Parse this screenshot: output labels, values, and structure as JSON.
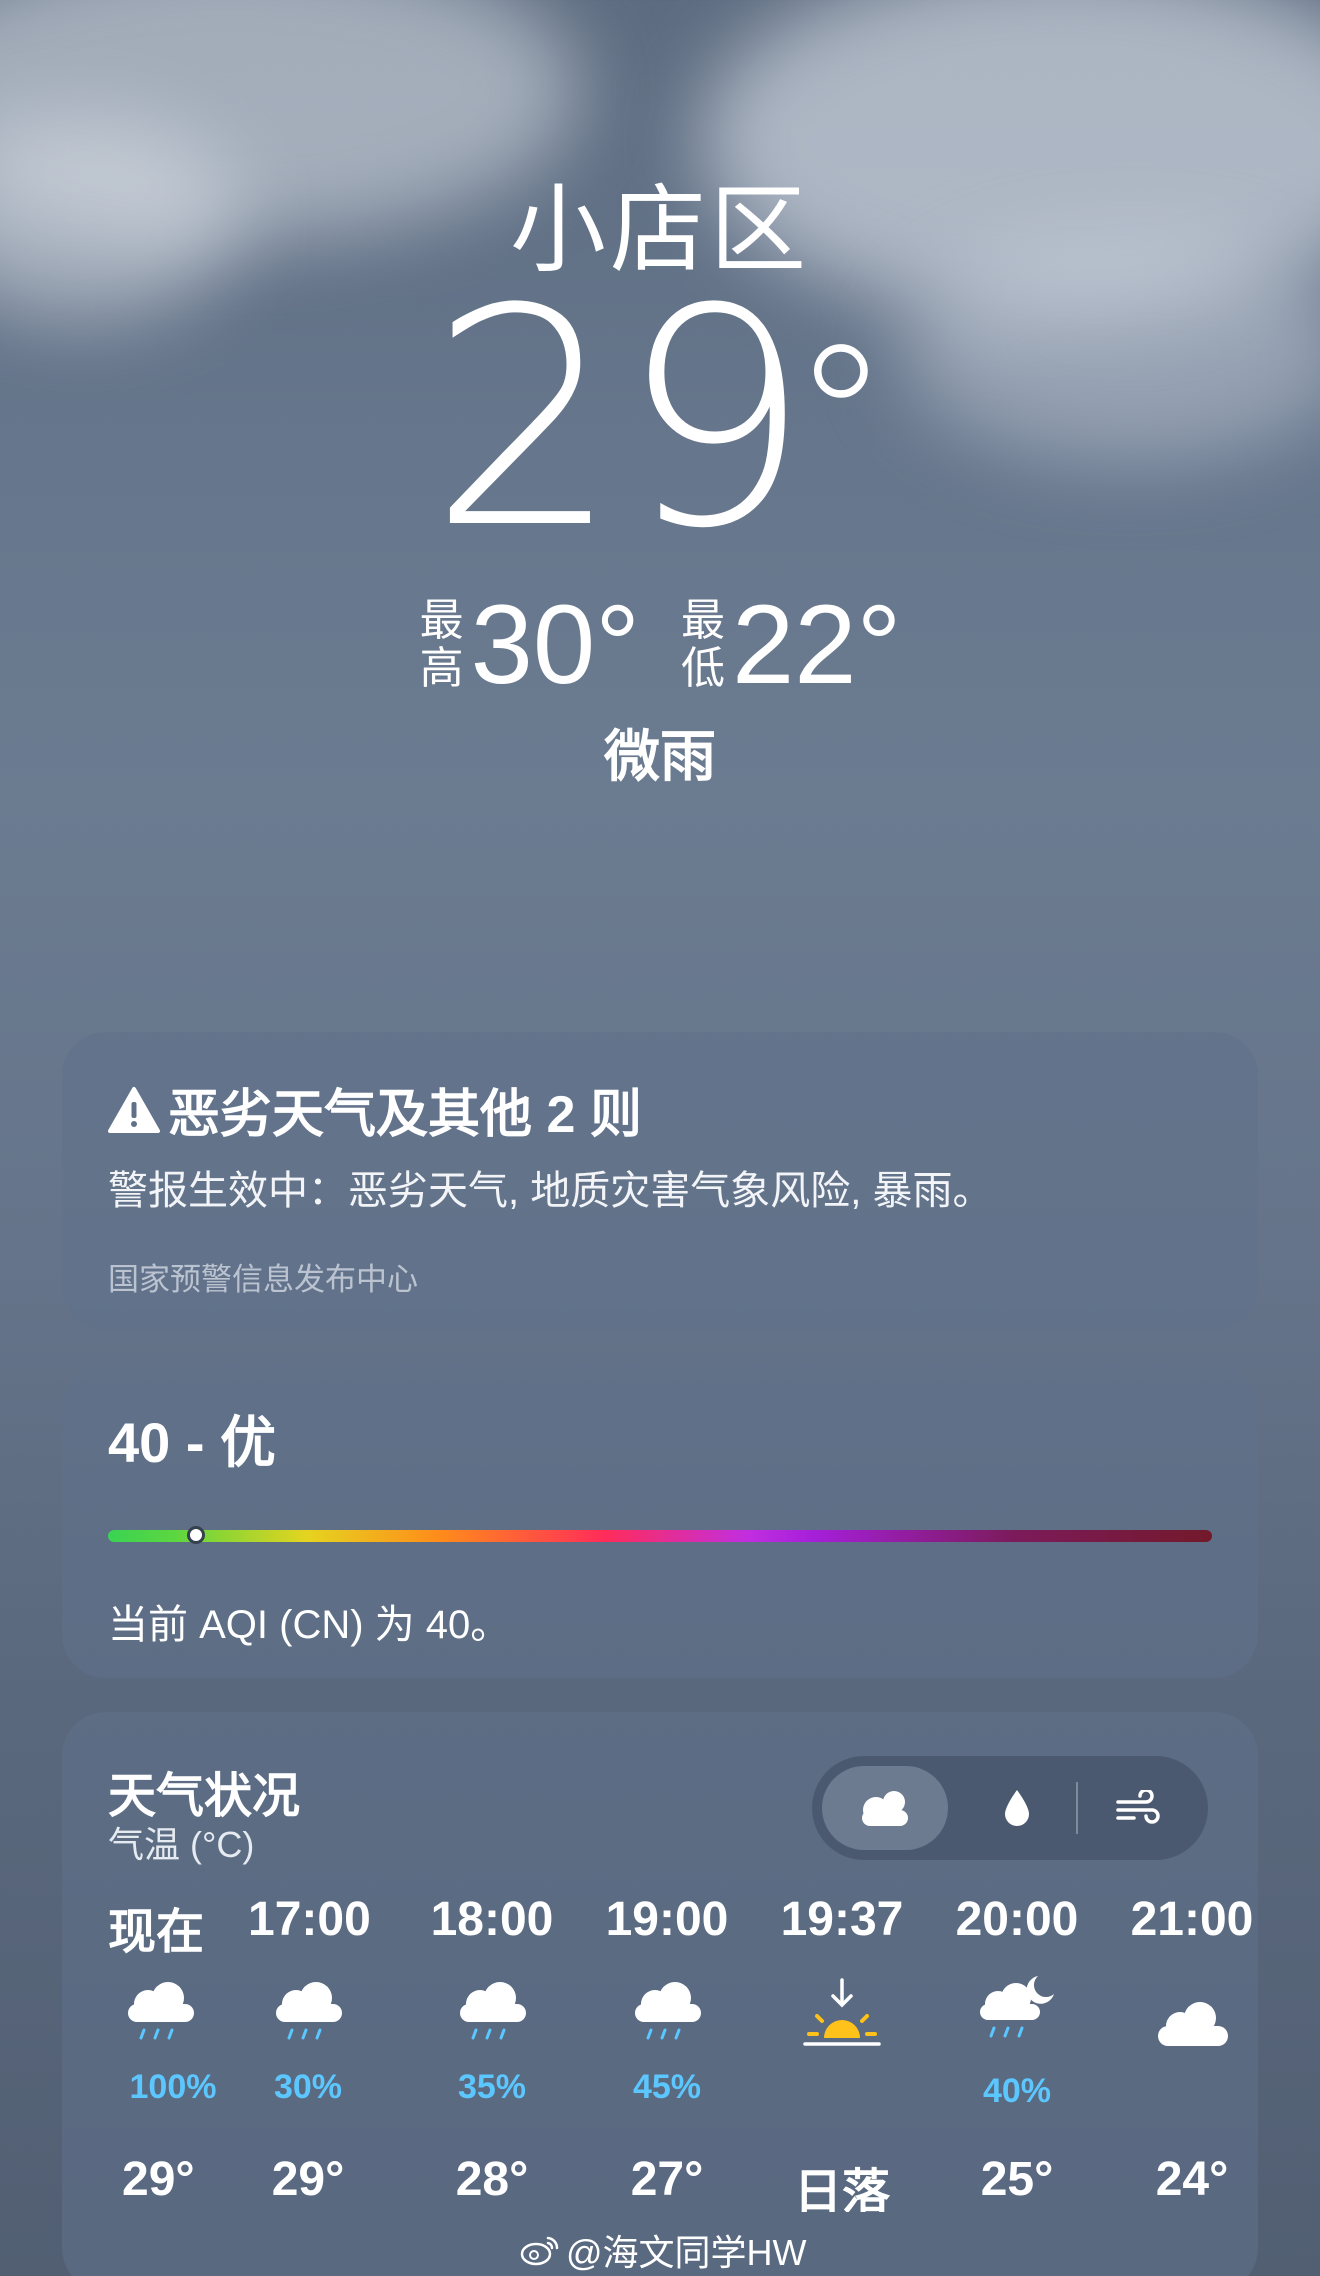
{
  "header": {
    "location": "小店区",
    "current_temp": "29",
    "high_label": "最高",
    "high_value": "30°",
    "low_label": "最低",
    "low_value": "22°",
    "condition": "微雨"
  },
  "alert": {
    "title": "恶劣天气及其他 2 则",
    "body": "警报生效中：恶劣天气, 地质灾害气象风险, 暴雨。",
    "source": "国家预警信息发布中心"
  },
  "aqi": {
    "title": "40 - 优",
    "value": 40,
    "description": "当前 AQI (CN) 为 40。"
  },
  "hourly": {
    "title": "天气状况",
    "subtitle": "气温 (°C)",
    "modes": [
      "cloud-icon",
      "drop-icon",
      "wind-icon"
    ],
    "items": [
      {
        "time": "现在",
        "icon": "rain-cloud-icon",
        "precip": "100%",
        "temp": "29°"
      },
      {
        "time": "17:00",
        "icon": "rain-cloud-icon",
        "precip": "30%",
        "temp": "29°"
      },
      {
        "time": "18:00",
        "icon": "rain-cloud-icon",
        "precip": "35%",
        "temp": "28°"
      },
      {
        "time": "19:00",
        "icon": "rain-cloud-icon",
        "precip": "45%",
        "temp": "27°"
      },
      {
        "time": "19:37",
        "icon": "sunset-icon",
        "precip": "",
        "temp": "日落"
      },
      {
        "time": "20:00",
        "icon": "night-rain-cloud-icon",
        "precip": "40%",
        "temp": "25°"
      },
      {
        "time": "21:00",
        "icon": "cloud-icon",
        "precip": "",
        "temp": "24°"
      }
    ]
  },
  "watermark": "@海文同学HW",
  "colors": {
    "precip": "#5cc7ff",
    "sun": "#ffc21a"
  }
}
